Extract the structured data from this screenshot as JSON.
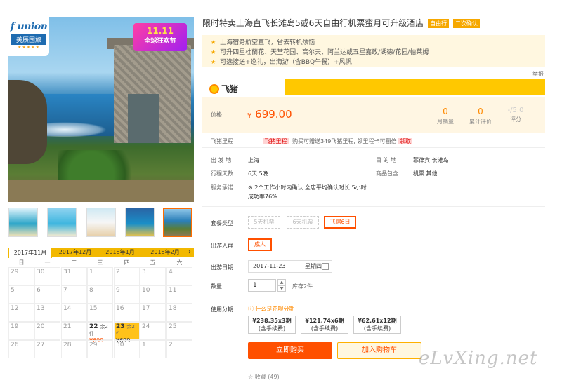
{
  "gallery": {
    "logo_script": "f union",
    "logo_cn": "美辰国旅",
    "logo_stars": "★★★★★",
    "promo_date": "11.11",
    "promo_text": "全球狂欢节"
  },
  "calendar": {
    "months": [
      "2017年11月",
      "2017年12月",
      "2018年1月",
      "2018年2月"
    ],
    "next_icon": "›",
    "weekdays": [
      "日",
      "一",
      "二",
      "三",
      "四",
      "五",
      "六"
    ],
    "rows": [
      [
        "29",
        "30",
        "31",
        "1",
        "2",
        "3",
        "4"
      ],
      [
        "5",
        "6",
        "7",
        "8",
        "9",
        "10",
        "11"
      ],
      [
        "12",
        "13",
        "14",
        "15",
        "16",
        "17",
        "18"
      ],
      [
        "19",
        "20",
        "21",
        "22",
        "23",
        "24",
        "25"
      ],
      [
        "26",
        "27",
        "28",
        "29",
        "30",
        "1",
        "2"
      ]
    ],
    "cells": {
      "d22": {
        "day": "22",
        "stock": "余2件",
        "price": "¥699"
      },
      "d23": {
        "day": "23",
        "stock": "余2件",
        "price": "¥699"
      }
    }
  },
  "product": {
    "title": "限时特卖上海直飞长滩岛5或6天自由行机票蜜月可升级酒店",
    "tags": [
      "自由行",
      "二次确认"
    ],
    "features": [
      "上海宿务航空直飞，省去转机烦恼",
      "可升四星杜蘭花、天堂花园、高尔夫、阿兰达或五星嘉政/湖德/花园/帕莱姆",
      "可选接送+巡礼，出海游（含BBQ午餐）+风帆"
    ],
    "report": "举报",
    "platform": "飞猪",
    "price_label": "价格",
    "price_currency": "¥",
    "price": "699.00",
    "stats": [
      {
        "value": "0",
        "label": "月销量"
      },
      {
        "value": "0",
        "label": "累计评价"
      },
      {
        "value": "-/5.0",
        "label": "评分"
      }
    ],
    "points_label": "飞猪里程",
    "points_tag": "飞猪里程",
    "points_text": "购买可赠送349飞猪里程, 领里程卡可翻倍",
    "points_link": "领取"
  },
  "info": {
    "depart_k": "出 发 地",
    "depart_v": "上海",
    "dest_k": "目 的 地",
    "dest_v": "菲律宾  长滩岛",
    "days_k": "行程天数",
    "days_v": "6天   5晚",
    "include_k": "商品包含",
    "include_v": "机票  其他",
    "promise_k": "服务承诺",
    "promise_v1": "⊘ 2个工作小时内确认  全店平均确认时长:5小时",
    "promise_v2": "成功率76%"
  },
  "options": {
    "package_label": "套餐类型",
    "packages": [
      "5天机票",
      "6天机票",
      "飞宿6日"
    ],
    "people_label": "出游人群",
    "people": "成人",
    "date_label": "出游日期",
    "date": "2017-11-23",
    "weekday": "星期四",
    "qty_label": "数量",
    "qty": "1",
    "stock": "库存2件",
    "installment_label": "使用分期",
    "installment_q": "ⓘ 什么是花呗分期",
    "installments": [
      {
        "amount": "¥238.35x3期",
        "note": "(含手续费)"
      },
      {
        "amount": "¥121.74x6期",
        "note": "(含手续费)"
      },
      {
        "amount": "¥62.61x12期",
        "note": "(含手续费)"
      }
    ],
    "buy": "立即购买",
    "cart": "加入购物车",
    "fav": "☆ 收藏 (49)"
  },
  "watermark": "eLvXing.net"
}
